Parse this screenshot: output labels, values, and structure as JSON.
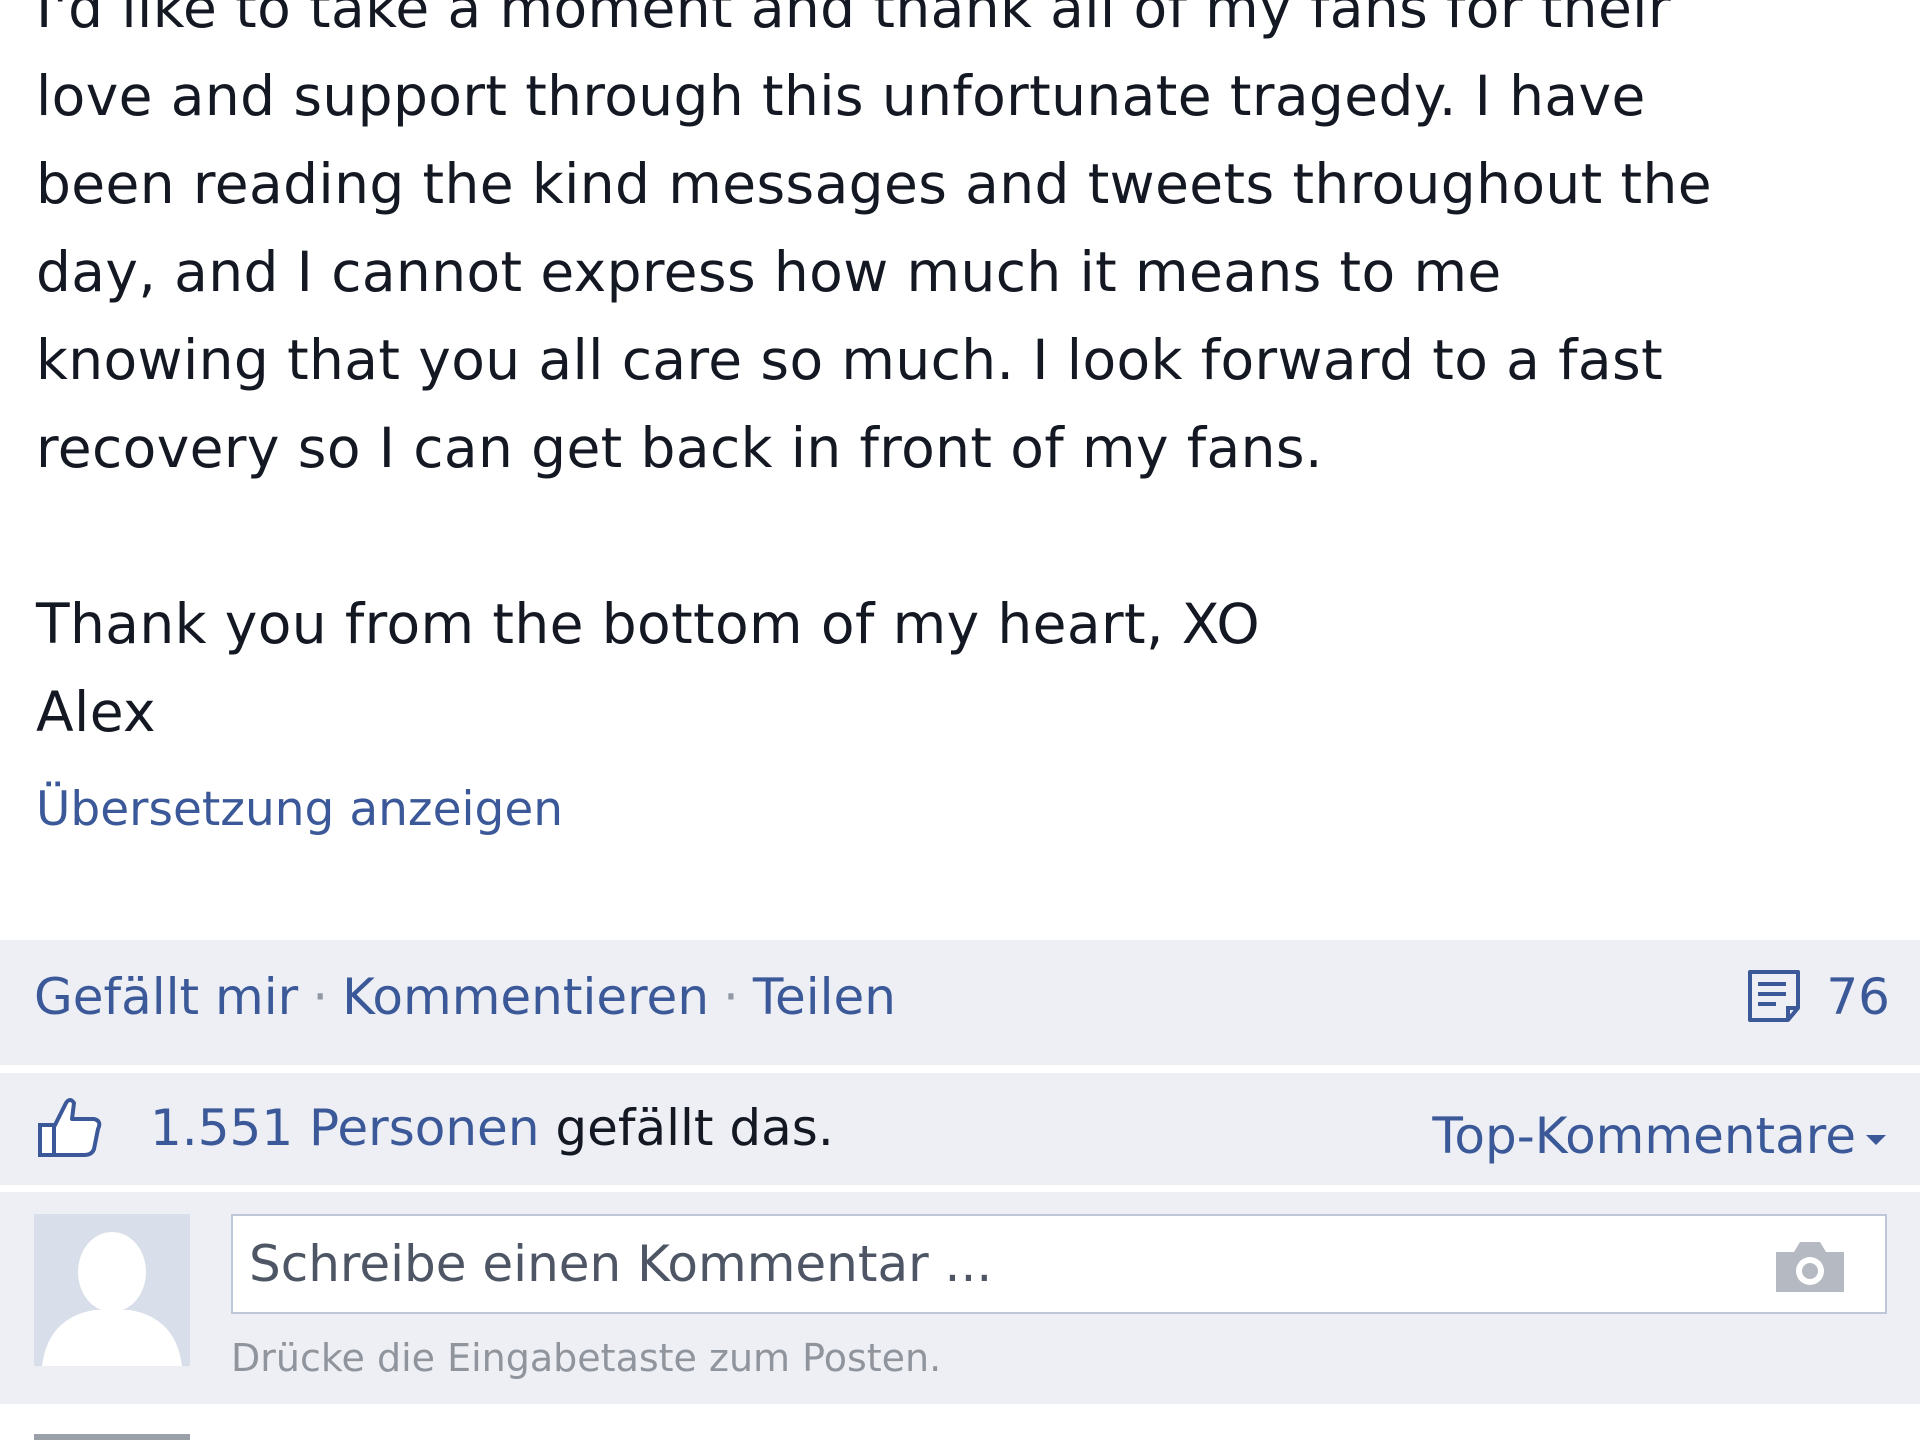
{
  "post": {
    "lines": [
      "I'd like to take a moment and thank all of my fans for their",
      "love and support through this unfortunate tragedy. I have",
      "been reading the kind messages and tweets throughout the",
      "day, and I cannot express how much it means to me",
      "knowing that you all care so much. I look forward to a fast",
      "recovery so I can get back in front of my fans.",
      "Thank you from the bottom of my heart, XO",
      "Alex"
    ],
    "translate_link": "Übersetzung anzeigen"
  },
  "actions": {
    "like": "Gefällt mir",
    "comment": "Kommentieren",
    "share": "Teilen",
    "separator": "·",
    "comment_count": "76",
    "comment_icon": "comment-bubble-icon"
  },
  "likes": {
    "count_link": "1.551 Personen",
    "suffix": " gefällt das.",
    "icon": "thumbs-up-icon",
    "top_comments": "Top-Kommentare"
  },
  "composer": {
    "placeholder": "Schreibe einen Kommentar ...",
    "hint": "Drücke die Eingabetaste zum Posten.",
    "camera_icon": "camera-icon",
    "avatar_icon": "default-avatar-icon"
  },
  "colors": {
    "link": "#3b5998",
    "text": "#141823",
    "panel": "#edeff4"
  }
}
